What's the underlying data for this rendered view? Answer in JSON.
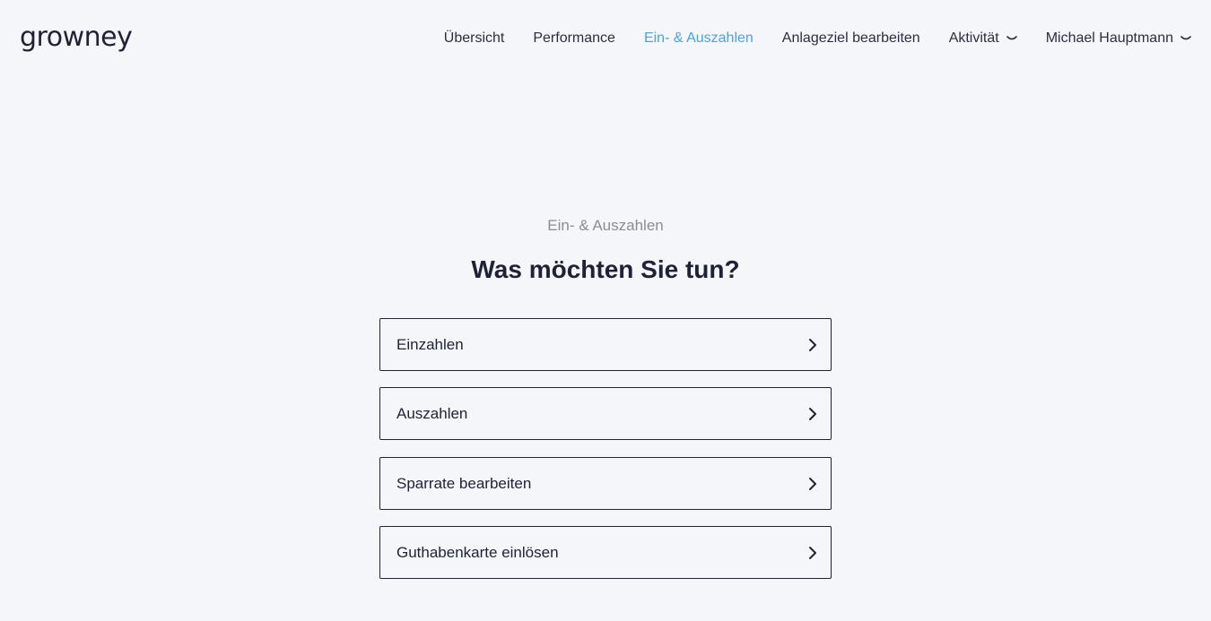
{
  "header": {
    "logo": "growney",
    "nav": [
      {
        "label": "Übersicht",
        "active": false,
        "dropdown": false
      },
      {
        "label": "Performance",
        "active": false,
        "dropdown": false
      },
      {
        "label": "Ein- & Auszahlen",
        "active": true,
        "dropdown": false
      },
      {
        "label": "Anlageziel bearbeiten",
        "active": false,
        "dropdown": false
      },
      {
        "label": "Aktivität",
        "active": false,
        "dropdown": true
      },
      {
        "label": "Michael Hauptmann",
        "active": false,
        "dropdown": true
      }
    ]
  },
  "main": {
    "subtitle": "Ein- & Auszahlen",
    "title": "Was möchten Sie tun?",
    "options": [
      {
        "label": "Einzahlen"
      },
      {
        "label": "Auszahlen"
      },
      {
        "label": "Sparrate bearbeiten"
      },
      {
        "label": "Guthabenkarte einlösen"
      }
    ]
  },
  "colors": {
    "background": "#f5f6f9",
    "text": "#1e2236",
    "accent": "#4aa3df",
    "muted": "#8a8d98"
  }
}
